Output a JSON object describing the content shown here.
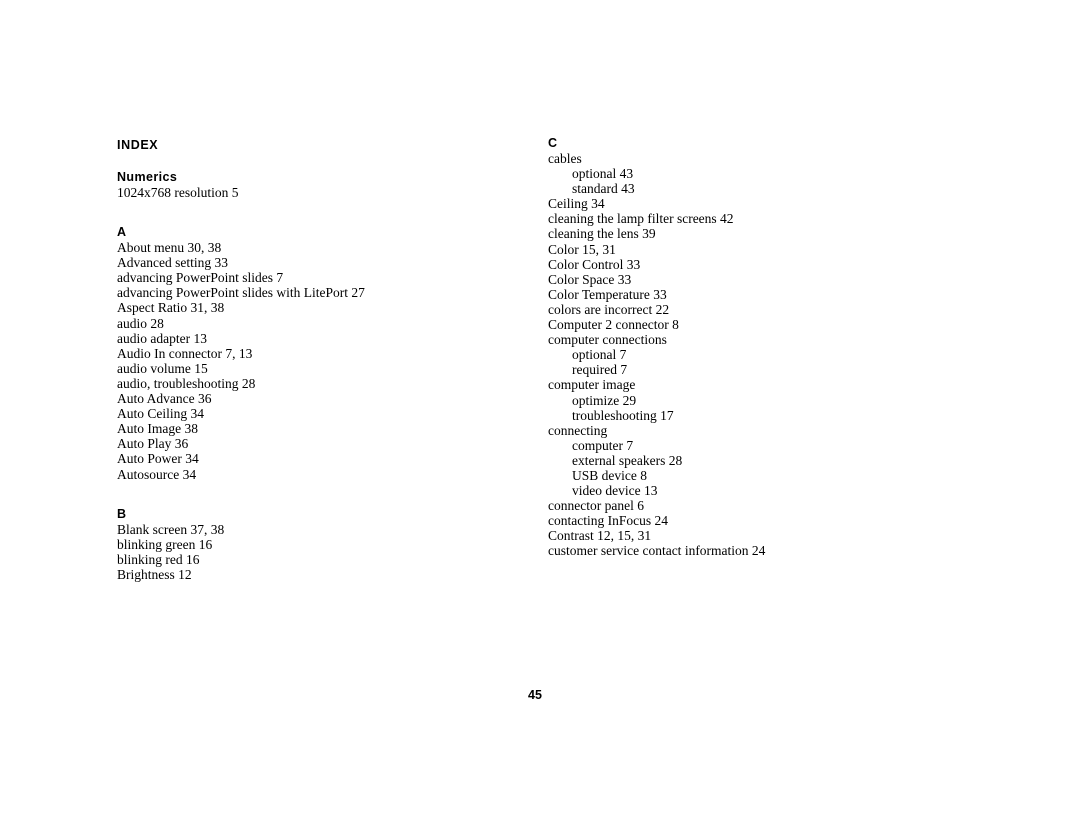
{
  "document": {
    "index_title": "INDEX",
    "page_number": "45",
    "text_color": "#000000",
    "background_color": "#ffffff"
  },
  "left_column": {
    "sections": [
      {
        "heading": "Numerics",
        "entries": [
          {
            "text": "1024x768 resolution 5",
            "level": 0
          }
        ]
      },
      {
        "heading": "A",
        "entries": [
          {
            "text": "About menu 30, 38",
            "level": 0
          },
          {
            "text": "Advanced setting 33",
            "level": 0
          },
          {
            "text": "advancing PowerPoint slides 7",
            "level": 0
          },
          {
            "text": "advancing PowerPoint slides with LitePort 27",
            "level": 0
          },
          {
            "text": "Aspect Ratio 31, 38",
            "level": 0
          },
          {
            "text": "audio 28",
            "level": 0
          },
          {
            "text": "audio adapter 13",
            "level": 0
          },
          {
            "text": "Audio In connector 7, 13",
            "level": 0
          },
          {
            "text": "audio volume 15",
            "level": 0
          },
          {
            "text": "audio, troubleshooting 28",
            "level": 0
          },
          {
            "text": "Auto Advance 36",
            "level": 0
          },
          {
            "text": "Auto Ceiling 34",
            "level": 0
          },
          {
            "text": "Auto Image 38",
            "level": 0
          },
          {
            "text": "Auto Play 36",
            "level": 0
          },
          {
            "text": "Auto Power 34",
            "level": 0
          },
          {
            "text": "Autosource 34",
            "level": 0
          }
        ]
      },
      {
        "heading": "B",
        "entries": [
          {
            "text": "Blank screen 37, 38",
            "level": 0
          },
          {
            "text": "blinking green 16",
            "level": 0
          },
          {
            "text": "blinking red 16",
            "level": 0
          },
          {
            "text": "Brightness 12",
            "level": 0
          }
        ]
      }
    ]
  },
  "right_column": {
    "sections": [
      {
        "heading": "C",
        "entries": [
          {
            "text": "cables",
            "level": 0
          },
          {
            "text": "optional 43",
            "level": 1
          },
          {
            "text": "standard 43",
            "level": 1
          },
          {
            "text": "Ceiling 34",
            "level": 0
          },
          {
            "text": "cleaning the lamp filter screens 42",
            "level": 0
          },
          {
            "text": "cleaning the lens 39",
            "level": 0
          },
          {
            "text": "Color 15, 31",
            "level": 0
          },
          {
            "text": "Color Control 33",
            "level": 0
          },
          {
            "text": "Color Space 33",
            "level": 0
          },
          {
            "text": "Color Temperature 33",
            "level": 0
          },
          {
            "text": "colors are incorrect 22",
            "level": 0
          },
          {
            "text": "Computer 2 connector 8",
            "level": 0
          },
          {
            "text": "computer connections",
            "level": 0
          },
          {
            "text": "optional 7",
            "level": 1
          },
          {
            "text": "required 7",
            "level": 1
          },
          {
            "text": "computer image",
            "level": 0
          },
          {
            "text": "optimize 29",
            "level": 1
          },
          {
            "text": "troubleshooting 17",
            "level": 1
          },
          {
            "text": "connecting",
            "level": 0
          },
          {
            "text": "computer 7",
            "level": 1
          },
          {
            "text": "external speakers 28",
            "level": 1
          },
          {
            "text": "USB device 8",
            "level": 1
          },
          {
            "text": "video device 13",
            "level": 1
          },
          {
            "text": "connector panel 6",
            "level": 0
          },
          {
            "text": "contacting InFocus 24",
            "level": 0
          },
          {
            "text": "Contrast 12, 15, 31",
            "level": 0
          },
          {
            "text": "customer service contact information 24",
            "level": 0
          }
        ]
      }
    ]
  }
}
